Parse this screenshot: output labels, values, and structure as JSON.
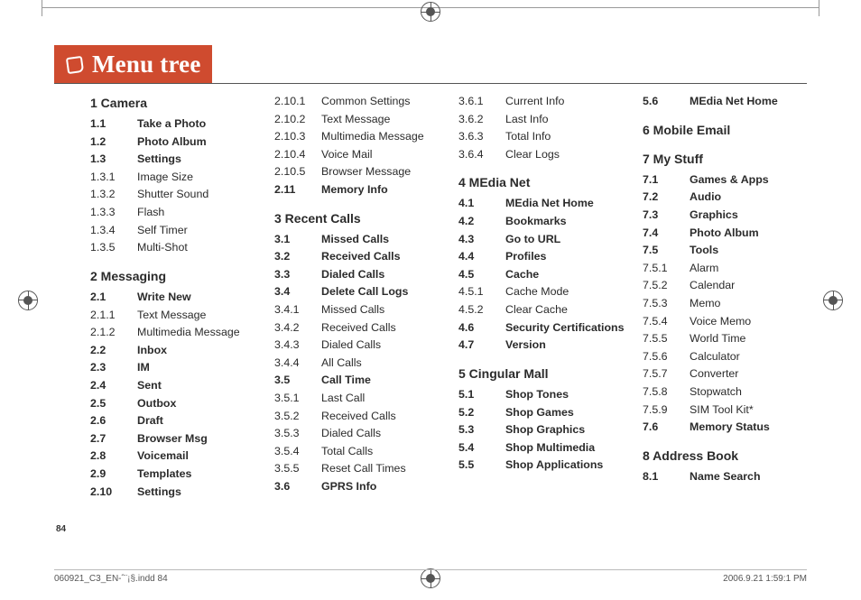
{
  "title": "Menu tree",
  "page_number": "84",
  "footer_left": "060921_C3_EN-ˆ¨¡§.indd   84",
  "footer_right": "2006.9.21   1:59:1 PM",
  "columns": [
    [
      {
        "type": "head",
        "text": "1 Camera"
      },
      {
        "type": "row",
        "bold": true,
        "num": "1.1",
        "label": "Take a Photo"
      },
      {
        "type": "row",
        "bold": true,
        "num": "1.2",
        "label": "Photo Album"
      },
      {
        "type": "row",
        "bold": true,
        "num": "1.3",
        "label": "Settings"
      },
      {
        "type": "row",
        "num": "1.3.1",
        "label": "Image Size"
      },
      {
        "type": "row",
        "num": "1.3.2",
        "label": "Shutter Sound"
      },
      {
        "type": "row",
        "num": "1.3.3",
        "label": "Flash"
      },
      {
        "type": "row",
        "num": "1.3.4",
        "label": "Self Timer"
      },
      {
        "type": "row",
        "num": "1.3.5",
        "label": "Multi-Shot"
      },
      {
        "type": "head",
        "text": "2 Messaging"
      },
      {
        "type": "row",
        "bold": true,
        "num": "2.1",
        "label": "Write New"
      },
      {
        "type": "row",
        "num": "2.1.1",
        "label": "Text Message"
      },
      {
        "type": "row",
        "num": "2.1.2",
        "label": "Multimedia Message"
      },
      {
        "type": "row",
        "bold": true,
        "num": "2.2",
        "label": "Inbox"
      },
      {
        "type": "row",
        "bold": true,
        "num": "2.3",
        "label": "IM"
      },
      {
        "type": "row",
        "bold": true,
        "num": "2.4",
        "label": "Sent"
      },
      {
        "type": "row",
        "bold": true,
        "num": "2.5",
        "label": "Outbox"
      },
      {
        "type": "row",
        "bold": true,
        "num": "2.6",
        "label": "Draft"
      },
      {
        "type": "row",
        "bold": true,
        "num": "2.7",
        "label": "Browser Msg"
      },
      {
        "type": "row",
        "bold": true,
        "num": "2.8",
        "label": "Voicemail"
      },
      {
        "type": "row",
        "bold": true,
        "num": "2.9",
        "label": "Templates"
      },
      {
        "type": "row",
        "bold": true,
        "num": "2.10",
        "label": "Settings"
      }
    ],
    [
      {
        "type": "row",
        "num": "2.10.1",
        "label": "Common Settings"
      },
      {
        "type": "row",
        "num": "2.10.2",
        "label": "Text Message"
      },
      {
        "type": "row",
        "num": "2.10.3",
        "label": "Multimedia Message"
      },
      {
        "type": "row",
        "num": "2.10.4",
        "label": "Voice Mail"
      },
      {
        "type": "row",
        "num": "2.10.5",
        "label": "Browser Message"
      },
      {
        "type": "row",
        "bold": true,
        "num": "2.11",
        "label": "Memory Info"
      },
      {
        "type": "head",
        "text": "3 Recent Calls"
      },
      {
        "type": "row",
        "bold": true,
        "num": "3.1",
        "label": "Missed Calls"
      },
      {
        "type": "row",
        "bold": true,
        "num": "3.2",
        "label": "Received Calls"
      },
      {
        "type": "row",
        "bold": true,
        "num": "3.3",
        "label": "Dialed Calls"
      },
      {
        "type": "row",
        "bold": true,
        "num": "3.4",
        "label": "Delete Call Logs"
      },
      {
        "type": "row",
        "num": "3.4.1",
        "label": "Missed Calls"
      },
      {
        "type": "row",
        "num": "3.4.2",
        "label": "Received Calls"
      },
      {
        "type": "row",
        "num": "3.4.3",
        "label": "Dialed Calls"
      },
      {
        "type": "row",
        "num": "3.4.4",
        "label": "All Calls"
      },
      {
        "type": "row",
        "bold": true,
        "num": "3.5",
        "label": "Call Time"
      },
      {
        "type": "row",
        "num": "3.5.1",
        "label": "Last Call"
      },
      {
        "type": "row",
        "num": "3.5.2",
        "label": "Received Calls"
      },
      {
        "type": "row",
        "num": "3.5.3",
        "label": "Dialed Calls"
      },
      {
        "type": "row",
        "num": "3.5.4",
        "label": "Total Calls"
      },
      {
        "type": "row",
        "num": "3.5.5",
        "label": "Reset Call Times"
      },
      {
        "type": "row",
        "bold": true,
        "num": "3.6",
        "label": "GPRS Info"
      }
    ],
    [
      {
        "type": "row",
        "num": "3.6.1",
        "label": "Current Info"
      },
      {
        "type": "row",
        "num": "3.6.2",
        "label": "Last Info"
      },
      {
        "type": "row",
        "num": "3.6.3",
        "label": "Total Info"
      },
      {
        "type": "row",
        "num": "3.6.4",
        "label": "Clear Logs"
      },
      {
        "type": "head",
        "text": "4 MEdia Net"
      },
      {
        "type": "row",
        "bold": true,
        "num": "4.1",
        "label": "MEdia Net Home"
      },
      {
        "type": "row",
        "bold": true,
        "num": "4.2",
        "label": "Bookmarks"
      },
      {
        "type": "row",
        "bold": true,
        "num": "4.3",
        "label": "Go to URL"
      },
      {
        "type": "row",
        "bold": true,
        "num": "4.4",
        "label": "Profiles"
      },
      {
        "type": "row",
        "bold": true,
        "num": "4.5",
        "label": "Cache"
      },
      {
        "type": "row",
        "num": "4.5.1",
        "label": "Cache Mode"
      },
      {
        "type": "row",
        "num": "4.5.2",
        "label": "Clear Cache"
      },
      {
        "type": "row",
        "bold": true,
        "num": "4.6",
        "label": "Security Certifications"
      },
      {
        "type": "row",
        "bold": true,
        "num": "4.7",
        "label": "Version"
      },
      {
        "type": "head",
        "text": "5 Cingular Mall"
      },
      {
        "type": "row",
        "bold": true,
        "num": "5.1",
        "label": "Shop Tones"
      },
      {
        "type": "row",
        "bold": true,
        "num": "5.2",
        "label": "Shop Games"
      },
      {
        "type": "row",
        "bold": true,
        "num": "5.3",
        "label": "Shop Graphics"
      },
      {
        "type": "row",
        "bold": true,
        "num": "5.4",
        "label": "Shop Multimedia"
      },
      {
        "type": "row",
        "bold": true,
        "num": "5.5",
        "label": "Shop Applications"
      }
    ],
    [
      {
        "type": "row",
        "bold": true,
        "num": "5.6",
        "label": "MEdia Net Home"
      },
      {
        "type": "head",
        "text": "6 Mobile Email"
      },
      {
        "type": "head",
        "text": "7 My Stuff"
      },
      {
        "type": "row",
        "bold": true,
        "num": "7.1",
        "label": "Games & Apps"
      },
      {
        "type": "row",
        "bold": true,
        "num": "7.2",
        "label": "Audio"
      },
      {
        "type": "row",
        "bold": true,
        "num": "7.3",
        "label": "Graphics"
      },
      {
        "type": "row",
        "bold": true,
        "num": "7.4",
        "label": "Photo Album"
      },
      {
        "type": "row",
        "bold": true,
        "num": "7.5",
        "label": "Tools"
      },
      {
        "type": "row",
        "num": "7.5.1",
        "label": "Alarm"
      },
      {
        "type": "row",
        "num": "7.5.2",
        "label": "Calendar"
      },
      {
        "type": "row",
        "num": "7.5.3",
        "label": "Memo"
      },
      {
        "type": "row",
        "num": "7.5.4",
        "label": "Voice Memo"
      },
      {
        "type": "row",
        "num": "7.5.5",
        "label": "World Time"
      },
      {
        "type": "row",
        "num": "7.5.6",
        "label": "Calculator"
      },
      {
        "type": "row",
        "num": "7.5.7",
        "label": "Converter"
      },
      {
        "type": "row",
        "num": "7.5.8",
        "label": "Stopwatch"
      },
      {
        "type": "row",
        "num": "7.5.9",
        "label": "SIM Tool Kit*"
      },
      {
        "type": "row",
        "bold": true,
        "num": "7.6",
        "label": "Memory Status"
      },
      {
        "type": "head",
        "text": "8 Address Book"
      },
      {
        "type": "row",
        "bold": true,
        "num": "8.1",
        "label": "Name Search"
      }
    ]
  ]
}
